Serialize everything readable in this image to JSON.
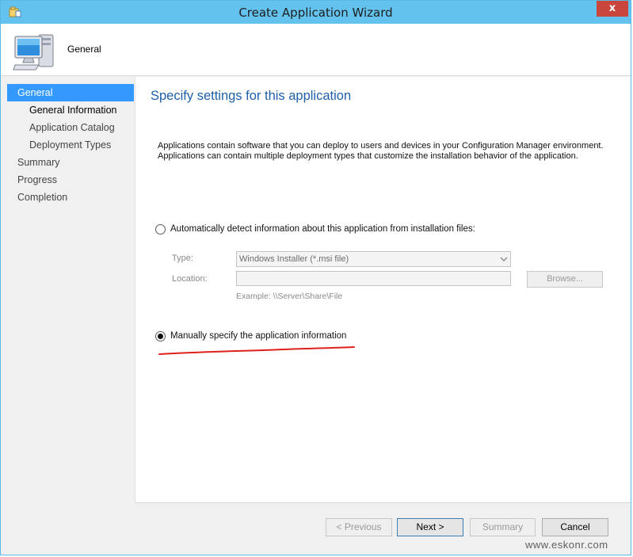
{
  "window": {
    "title": "Create Application Wizard",
    "close_glyph": "x",
    "header_title": "General"
  },
  "nav": {
    "items": [
      {
        "label": "General",
        "level": 0,
        "active": true
      },
      {
        "label": "General Information",
        "level": 1,
        "current": true
      },
      {
        "label": "Application Catalog",
        "level": 1
      },
      {
        "label": "Deployment Types",
        "level": 1
      },
      {
        "label": "Summary",
        "level": 0
      },
      {
        "label": "Progress",
        "level": 0
      },
      {
        "label": "Completion",
        "level": 0
      }
    ]
  },
  "content": {
    "title": "Specify settings for this application",
    "intro_line1": "Applications contain software that you can deploy to users and devices in your Configuration Manager environment.",
    "intro_line2": "Applications can contain multiple deployment types that customize the installation behavior of the application.",
    "auto_detect_label": "Automatically detect information about this application from installation files:",
    "auto_detect_checked": false,
    "type_label": "Type:",
    "type_value": "Windows Installer (*.msi file)",
    "location_label": "Location:",
    "location_value": "",
    "browse_label": "Browse...",
    "example_text": "Example: \\\\Server\\Share\\File",
    "manual_label": "Manually specify the application information",
    "manual_checked": true
  },
  "footer": {
    "previous_label": "< Previous",
    "next_label": "Next >",
    "summary_label": "Summary",
    "cancel_label": "Cancel"
  },
  "watermark": "www.eskonr.com",
  "colors": {
    "titlebar": "#63c3ee",
    "nav_active": "#3399ff",
    "page_title": "#1e5fa8",
    "close_button": "#c9463d",
    "annotation_underline": "#e0201c"
  }
}
